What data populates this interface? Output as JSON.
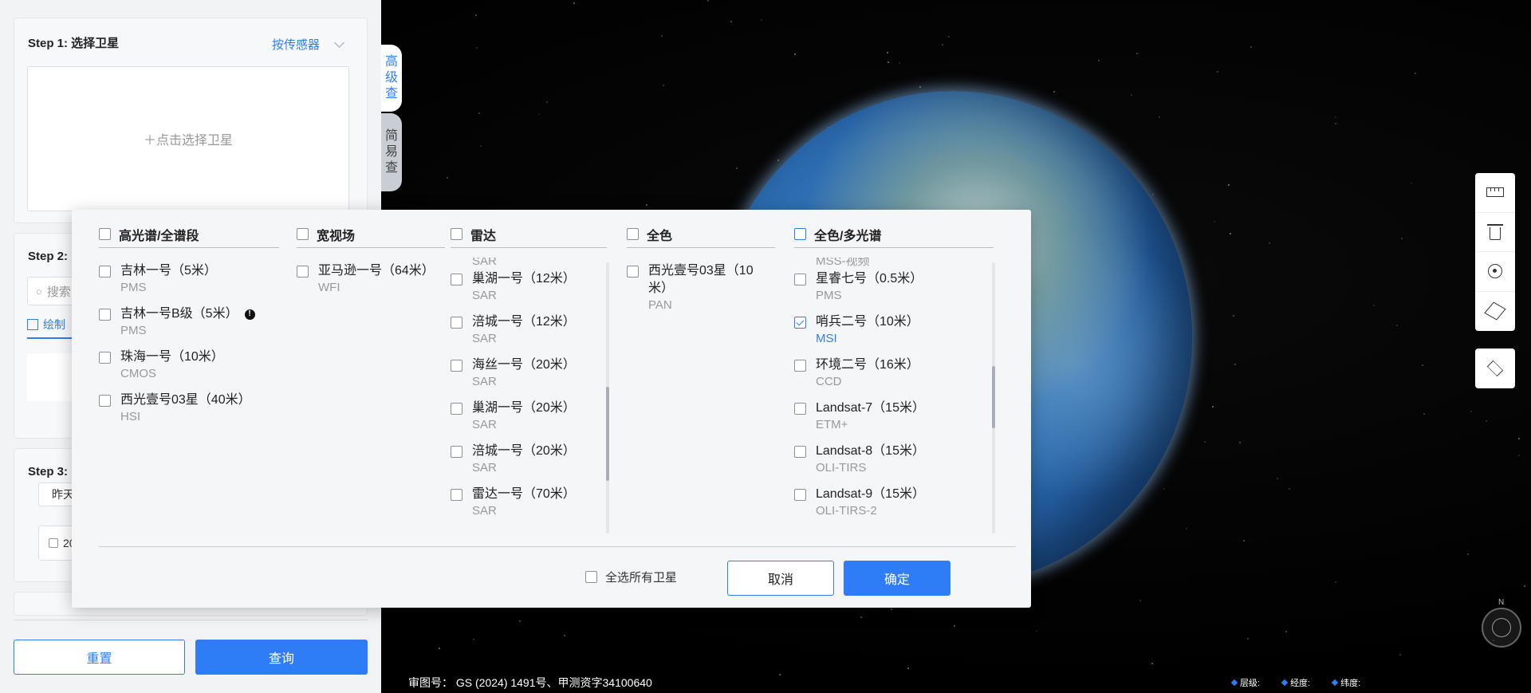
{
  "left_panel": {
    "step1": {
      "title": "Step 1: 选择卫星",
      "sensor_toggle": "按传感器",
      "select_prompt": "＋点击选择卫星"
    },
    "step2": {
      "title": "Step 2:",
      "search_placeholder": "搜索",
      "tab_draw": "绘制"
    },
    "step3": {
      "title": "Step 3:",
      "quick_date": "昨天",
      "date_value": "20"
    },
    "reset_label": "重置",
    "query_label": "查询"
  },
  "side_tabs": {
    "advanced": [
      "高",
      "级",
      "查"
    ],
    "simple": [
      "简",
      "易",
      "查"
    ]
  },
  "modal": {
    "columns": [
      {
        "title": "高光谱/全谱段",
        "items": [
          {
            "name": "吉林一号（5米）",
            "sensor": "PMS",
            "checked": false
          },
          {
            "name": "吉林一号B级（5米）",
            "sensor": "PMS",
            "checked": false,
            "warning": "!"
          },
          {
            "name": "珠海一号（10米）",
            "sensor": "CMOS",
            "checked": false
          },
          {
            "name": "西光壹号03星（40米）",
            "sensor": "HSI",
            "checked": false
          }
        ]
      },
      {
        "title": "宽视场",
        "items": [
          {
            "name": "亚马逊一号（64米）",
            "sensor": "WFI",
            "checked": false
          }
        ]
      },
      {
        "title": "雷达",
        "partial_top": "SAR",
        "items": [
          {
            "name": "巢湖一号（12米）",
            "sensor": "SAR",
            "checked": false
          },
          {
            "name": "涪城一号（12米）",
            "sensor": "SAR",
            "checked": false
          },
          {
            "name": "海丝一号（20米）",
            "sensor": "SAR",
            "checked": false
          },
          {
            "name": "巢湖一号（20米）",
            "sensor": "SAR",
            "checked": false
          },
          {
            "name": "涪城一号（20米）",
            "sensor": "SAR",
            "checked": false
          },
          {
            "name": "雷达一号（70米）",
            "sensor": "SAR",
            "checked": false
          }
        ]
      },
      {
        "title": "全色",
        "items": [
          {
            "name": "西光壹号03星（10米）",
            "sensor": "PAN",
            "checked": false
          }
        ]
      },
      {
        "title": "全色/多光谱",
        "partial_top": "MSS-视频",
        "items": [
          {
            "name": "星睿七号（0.5米）",
            "sensor": "PMS",
            "checked": false
          },
          {
            "name": "哨兵二号（10米）",
            "sensor": "MSI",
            "checked": true
          },
          {
            "name": "环境二号（16米）",
            "sensor": "CCD",
            "checked": false
          },
          {
            "name": "Landsat-7（15米）",
            "sensor": "ETM+",
            "checked": false
          },
          {
            "name": "Landsat-8（15米）",
            "sensor": "OLI-TIRS",
            "checked": false
          },
          {
            "name": "Landsat-9（15米）",
            "sensor": "OLI-TIRS-2",
            "checked": false
          }
        ]
      }
    ],
    "select_all_label": "全选所有卫星",
    "cancel_label": "取消",
    "confirm_label": "确定"
  },
  "footer": {
    "approval": "审图号： GS (2024) 1491号、甲测资字34100640",
    "level_label": "层级:",
    "lon_label": "经度:",
    "lat_label": "纬度:"
  },
  "compass_label": "N",
  "colors": {
    "accent": "#2f7df6",
    "panel_bg": "#f2f3f5"
  }
}
